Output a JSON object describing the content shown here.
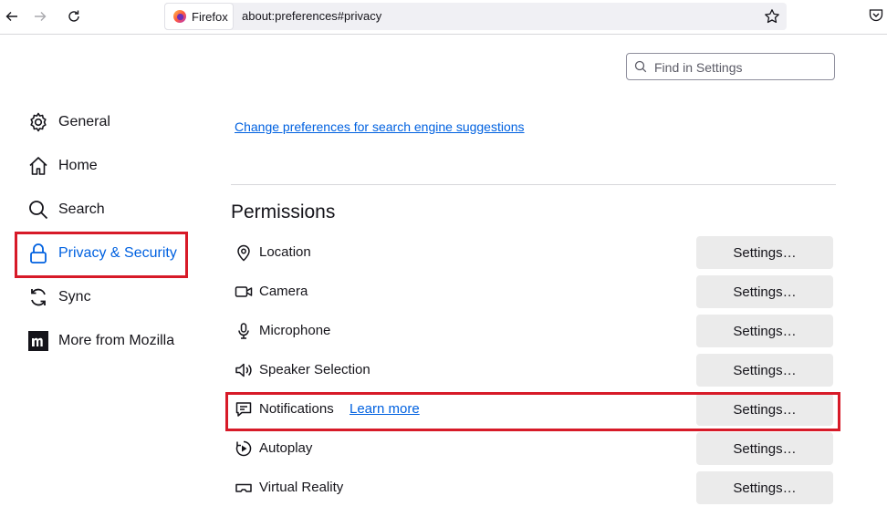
{
  "browser": {
    "identity_label": "Firefox",
    "url": "about:preferences#privacy"
  },
  "search": {
    "placeholder": "Find in Settings"
  },
  "sidebar": {
    "items": [
      {
        "label": "General",
        "icon": "gear-icon"
      },
      {
        "label": "Home",
        "icon": "home-icon"
      },
      {
        "label": "Search",
        "icon": "search-icon"
      },
      {
        "label": "Privacy & Security",
        "icon": "lock-icon",
        "selected": true
      },
      {
        "label": "Sync",
        "icon": "sync-icon"
      },
      {
        "label": "More from Mozilla",
        "icon": "mozilla-icon"
      }
    ]
  },
  "main": {
    "search_suggestions_link": "Change preferences for search engine suggestions",
    "permissions": {
      "title": "Permissions",
      "items": [
        {
          "label": "Location",
          "icon": "location-icon",
          "button": "Settings…"
        },
        {
          "label": "Camera",
          "icon": "camera-icon",
          "button": "Settings…"
        },
        {
          "label": "Microphone",
          "icon": "microphone-icon",
          "button": "Settings…"
        },
        {
          "label": "Speaker Selection",
          "icon": "speaker-icon",
          "button": "Settings…"
        },
        {
          "label": "Notifications",
          "icon": "notification-icon",
          "button": "Settings…",
          "learn_more": "Learn more"
        },
        {
          "label": "Autoplay",
          "icon": "autoplay-icon",
          "button": "Settings…"
        },
        {
          "label": "Virtual Reality",
          "icon": "vr-icon",
          "button": "Settings…"
        }
      ]
    }
  },
  "colors": {
    "accent": "#0061e0",
    "highlight": "#d71a28",
    "button_bg": "#ebebeb"
  }
}
